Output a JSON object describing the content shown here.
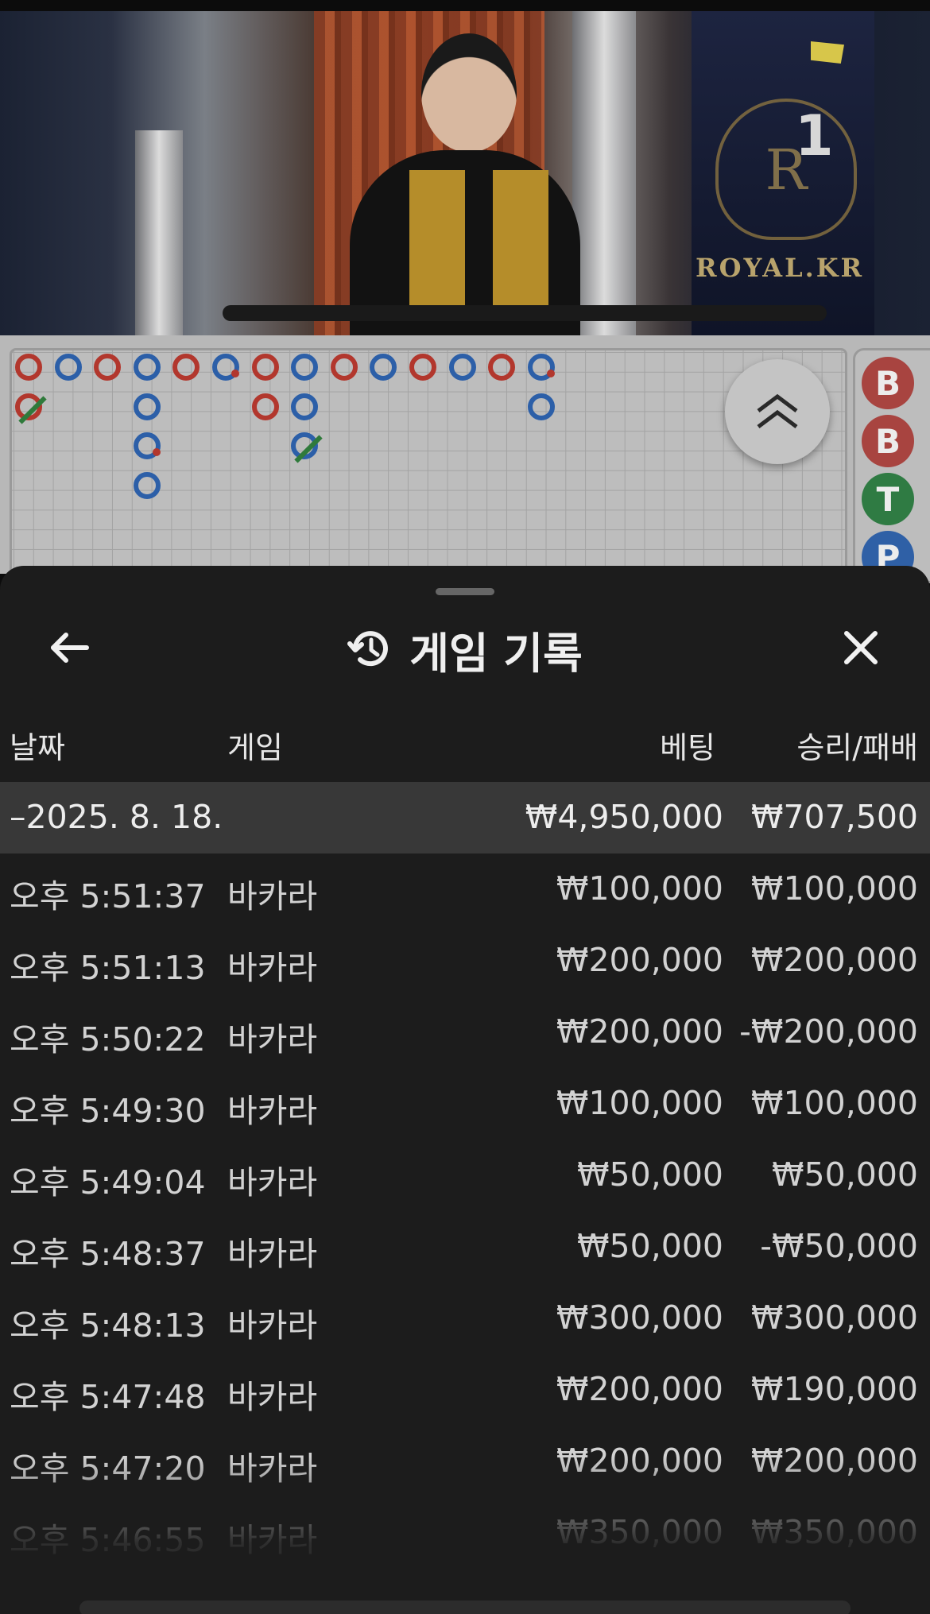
{
  "video": {
    "table_number": "1",
    "brand": "ROYAL.KR",
    "crest_letter": "R"
  },
  "road": {
    "bead_marks": [
      {
        "col": 0,
        "row": 0,
        "color": "red"
      },
      {
        "col": 0,
        "row": 1,
        "color": "red",
        "tie": true
      },
      {
        "col": 1,
        "row": 0,
        "color": "blue"
      },
      {
        "col": 2,
        "row": 0,
        "color": "red"
      },
      {
        "col": 3,
        "row": 0,
        "color": "blue"
      },
      {
        "col": 3,
        "row": 1,
        "color": "blue"
      },
      {
        "col": 3,
        "row": 2,
        "color": "blue",
        "pair": true
      },
      {
        "col": 3,
        "row": 3,
        "color": "blue"
      },
      {
        "col": 4,
        "row": 0,
        "color": "red"
      },
      {
        "col": 5,
        "row": 0,
        "color": "blue",
        "pair": true
      },
      {
        "col": 6,
        "row": 0,
        "color": "red"
      },
      {
        "col": 6,
        "row": 1,
        "color": "red"
      },
      {
        "col": 7,
        "row": 0,
        "color": "blue"
      },
      {
        "col": 7,
        "row": 1,
        "color": "blue"
      },
      {
        "col": 7,
        "row": 2,
        "color": "blue",
        "tie": true
      },
      {
        "col": 8,
        "row": 0,
        "color": "red"
      },
      {
        "col": 9,
        "row": 0,
        "color": "blue"
      },
      {
        "col": 10,
        "row": 0,
        "color": "red"
      },
      {
        "col": 11,
        "row": 0,
        "color": "blue"
      },
      {
        "col": 12,
        "row": 0,
        "color": "red"
      },
      {
        "col": 13,
        "row": 0,
        "color": "blue",
        "pair": true
      },
      {
        "col": 13,
        "row": 1,
        "color": "blue"
      }
    ],
    "result_bubbles": [
      "B",
      "B",
      "T",
      "P"
    ],
    "expand_icon": "double-chevron-up-icon"
  },
  "sheet": {
    "title": "게임 기록",
    "title_icon": "history-icon",
    "back_icon": "arrow-left-icon",
    "close_icon": "close-icon",
    "columns": {
      "date": "날짜",
      "game": "게임",
      "bet": "베팅",
      "win_loss": "승리/패배"
    },
    "group": {
      "date": "–2025. 8. 18.",
      "bet_total": "₩4,950,000",
      "win_loss_total": "₩707,500"
    },
    "rows": [
      {
        "time": "오후 5:51:37",
        "game": "바카라",
        "bet": "₩100,000",
        "win_loss": "₩100,000"
      },
      {
        "time": "오후 5:51:13",
        "game": "바카라",
        "bet": "₩200,000",
        "win_loss": "₩200,000"
      },
      {
        "time": "오후 5:50:22",
        "game": "바카라",
        "bet": "₩200,000",
        "win_loss": "-₩200,000"
      },
      {
        "time": "오후 5:49:30",
        "game": "바카라",
        "bet": "₩100,000",
        "win_loss": "₩100,000"
      },
      {
        "time": "오후 5:49:04",
        "game": "바카라",
        "bet": "₩50,000",
        "win_loss": "₩50,000"
      },
      {
        "time": "오후 5:48:37",
        "game": "바카라",
        "bet": "₩50,000",
        "win_loss": "-₩50,000"
      },
      {
        "time": "오후 5:48:13",
        "game": "바카라",
        "bet": "₩300,000",
        "win_loss": "₩300,000"
      },
      {
        "time": "오후 5:47:48",
        "game": "바카라",
        "bet": "₩200,000",
        "win_loss": "₩190,000"
      },
      {
        "time": "오후 5:47:20",
        "game": "바카라",
        "bet": "₩200,000",
        "win_loss": "₩200,000"
      },
      {
        "time": "오후 5:46:55",
        "game": "바카라",
        "bet": "₩350,000",
        "win_loss": "₩350,000"
      }
    ]
  }
}
